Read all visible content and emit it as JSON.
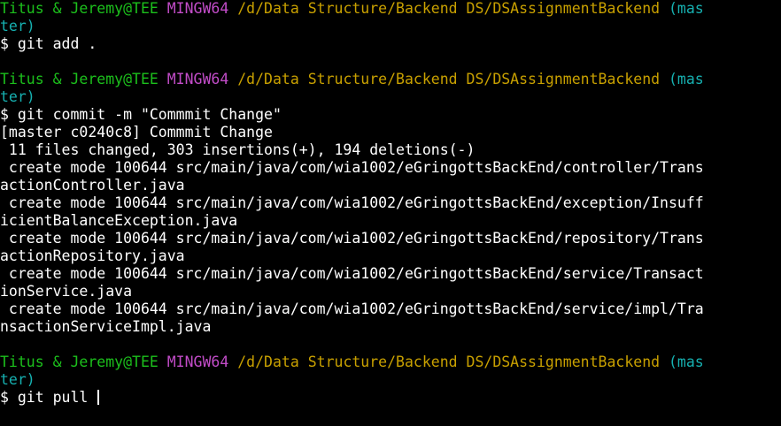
{
  "colors": {
    "background": "#000000",
    "user": "#1cc01c",
    "msystem": "#c24cc8",
    "path": "#c8a000",
    "branch": "#16b0b0",
    "text": "#ffffff"
  },
  "prompt": {
    "user_host": "Titus & Jeremy@TEE",
    "msystem": "MINGW64",
    "path": "/d/Data Structure/Backend DS/DSAssignmentBackend",
    "branch_start": "(mas",
    "branch_end": "ter)"
  },
  "commands": {
    "cmd1": "$ git add .",
    "cmd2": "$ git commit -m \"Commmit Change\"",
    "cmd3": "$ git pull "
  },
  "output": {
    "commit_header": "[master c0240c8] Commmit Change",
    "summary": " 11 files changed, 303 insertions(+), 194 deletions(-)",
    "lines": [
      " create mode 100644 src/main/java/com/wia1002/eGringottsBackEnd/controller/Trans",
      "actionController.java",
      " create mode 100644 src/main/java/com/wia1002/eGringottsBackEnd/exception/Insuff",
      "icientBalanceException.java",
      " create mode 100644 src/main/java/com/wia1002/eGringottsBackEnd/repository/Trans",
      "actionRepository.java",
      " create mode 100644 src/main/java/com/wia1002/eGringottsBackEnd/service/Transact",
      "ionService.java",
      " create mode 100644 src/main/java/com/wia1002/eGringottsBackEnd/service/impl/Tra",
      "nsactionServiceImpl.java"
    ]
  }
}
